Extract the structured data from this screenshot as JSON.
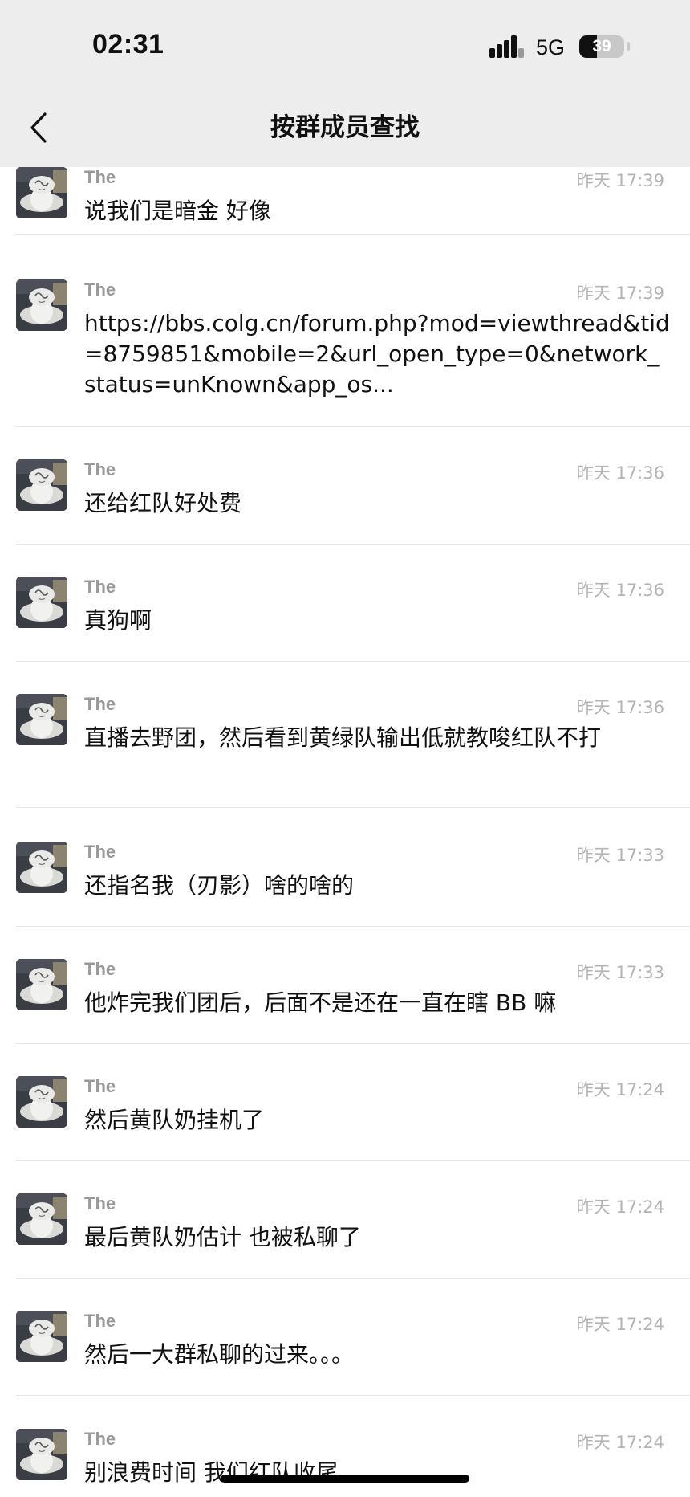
{
  "status_bar": {
    "time": "02:31",
    "network": "5G",
    "battery": "39",
    "battery_level_percent": 39
  },
  "nav": {
    "title": "按群成员查找",
    "back_icon": "chevron-left-icon"
  },
  "colors": {
    "background": "#ffffff",
    "bar_background": "#ededed",
    "name_gray": "#9a9a9a",
    "time_gray": "#b4b4b4",
    "divider": "#e6e6e6"
  },
  "messages": [
    {
      "sender": "The",
      "time": "昨天 17:39",
      "text": "说我们是暗金 好像"
    },
    {
      "sender": "The",
      "time": "昨天 17:39",
      "text": "https://bbs.colg.cn/forum.php?mod=viewthread&tid=8759851&mobile=2&url_open_type=0&network_status=unKnown&app_os..."
    },
    {
      "sender": "The",
      "time": "昨天 17:36",
      "text": "还给红队好处费"
    },
    {
      "sender": "The",
      "time": "昨天 17:36",
      "text": "真狗啊"
    },
    {
      "sender": "The",
      "time": "昨天 17:36",
      "text": "直播去野团，然后看到黄绿队输出低就教唆红队不打"
    },
    {
      "sender": "The",
      "time": "昨天 17:33",
      "text": "还指名我（刃影）啥的啥的"
    },
    {
      "sender": "The",
      "time": "昨天 17:33",
      "text": "他炸完我们团后，后面不是还在一直在瞎 BB 嘛"
    },
    {
      "sender": "The",
      "time": "昨天 17:24",
      "text": "然后黄队奶挂机了"
    },
    {
      "sender": "The",
      "time": "昨天 17:24",
      "text": "最后黄队奶估计 也被私聊了"
    },
    {
      "sender": "The",
      "time": "昨天 17:24",
      "text": "然后一大群私聊的过来。。。"
    },
    {
      "sender": "The",
      "time": "昨天 17:24",
      "text": "别浪费时间 我们红队收尾"
    }
  ]
}
